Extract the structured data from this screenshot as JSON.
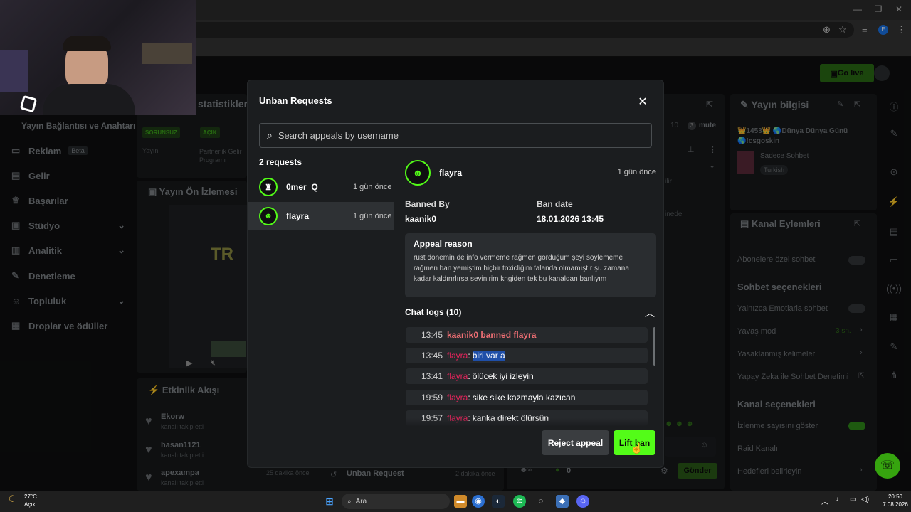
{
  "dashboard": {
    "sidebar_header": "Yayın Bağlantısı ve Anahtarı",
    "sidebar": [
      {
        "label": "Reklam",
        "badge": "Beta",
        "icon": "ad-icon"
      },
      {
        "label": "Gelir",
        "icon": "money-icon"
      },
      {
        "label": "Başarılar",
        "icon": "trophy-icon"
      },
      {
        "label": "Stüdyo",
        "icon": "studio-icon"
      },
      {
        "label": "Analitik",
        "icon": "chart-icon"
      },
      {
        "label": "Denetleme",
        "icon": "wrench-icon"
      },
      {
        "label": "Topluluk",
        "icon": "people-icon"
      },
      {
        "label": "Droplar ve ödüller",
        "icon": "gift-icon"
      }
    ],
    "stats_title": "statistikleri",
    "badge_problem": "SORUNSUZ",
    "badge_open": "AÇIK",
    "stat_col1": "Yayın",
    "stat_col2": "Partnerlik Gelir Programı",
    "preview_title": "Yayın Ön İzlemesi",
    "preview_logo": "TR",
    "activity_title": "Etkinlik Akışı",
    "activity": [
      {
        "name": "Ekorw",
        "sub": "kanalı takip etti"
      },
      {
        "name": "hasan1121",
        "sub": "kanalı takip etti"
      },
      {
        "name": "apexampa",
        "sub": "kanalı takip etti",
        "time": "25 dakika önce"
      }
    ],
    "unban_request_label": "Unban Request",
    "unban_request_time": "2 dakika önce",
    "mute_label": "mute",
    "mute_count": "3",
    "count_10": "10",
    "chat_snip1": "ilir",
    "chat_snip2": "inede",
    "go_live": "Go live",
    "stream_info_title": "Yayın bilgisi",
    "stream_title": "👑1453👑 🌎Dünya Dünya Günü 🌎!csgoskin",
    "category": "Sadece Sohbet",
    "language": "Turkish",
    "channel_actions_title": "Kanal Eylemleri",
    "subs_only_chat": "Abonelere özel sohbet",
    "chat_options_title": "Sohbet seçenekleri",
    "emotes_only": "Yalnızca Emotlarla sohbet",
    "slow_mode": "Yavaş mod",
    "slow_mode_value": "3 sn.",
    "banned_words": "Yasaklanmış kelimeler",
    "ai_moderation": "Yapay Zeka ile Sohbet Denetimi",
    "channel_options_title": "Kanal seçenekleri",
    "show_viewers": "İzlenme sayısını göster",
    "raid_channel": "Raid Kanalı",
    "set_goals": "Hedefleri belirleyin",
    "send": "Gönder",
    "footer_count": "0"
  },
  "modal": {
    "title": "Unban Requests",
    "close_icon": "close-icon",
    "search_placeholder": "Search appeals by username",
    "request_count": "2 requests",
    "requests": [
      {
        "username": "0mer_Q",
        "time": "1 gün önce",
        "avatar": "bjk-crest"
      },
      {
        "username": "flayra",
        "time": "1 gün önce",
        "avatar": "green-avatar",
        "selected": true
      }
    ],
    "detail": {
      "username": "flayra",
      "time": "1 gün önce",
      "banned_by_label": "Banned By",
      "banned_by": "kaanik0",
      "ban_date_label": "Ban date",
      "ban_date": "18.01.2026 13:45",
      "appeal_reason_label": "Appeal reason",
      "appeal_reason": "rust dönemin de info vermeme rağmen gördüğüm şeyi söylememe rağmen ban yemiştim hiçbir toxicliğim falanda olmamıştır şu zamana kadar kaldırırlırsa sevinirim kngiden tek bu kanaldan banlıyım",
      "chat_logs_label": "Chat logs (10)",
      "logs": [
        {
          "time": "13:45",
          "user": "",
          "text": "kaanik0 banned flayra",
          "type": "ban"
        },
        {
          "time": "13:45",
          "user": "flayra",
          "text": "biri var a",
          "type": "msg"
        },
        {
          "time": "13:41",
          "user": "flayra",
          "text": "ölücek iyi izleyin",
          "type": "msg"
        },
        {
          "time": "19:59",
          "user": "flayra",
          "text": "sike sike kazmayla kazıcan",
          "type": "msg"
        },
        {
          "time": "19:57",
          "user": "flayra",
          "text": "kanka direkt ölürsün",
          "type": "msg"
        }
      ]
    },
    "reject_label": "Reject appeal",
    "lift_label": "Lift ban"
  },
  "colors": {
    "accent": "#53fc18",
    "username": "#e8245c",
    "ban_text": "#ef6f74"
  },
  "taskbar": {
    "temp": "27°C",
    "weather": "Açık",
    "search": "Ara",
    "time": "20:50",
    "date": "7.08.2026"
  }
}
